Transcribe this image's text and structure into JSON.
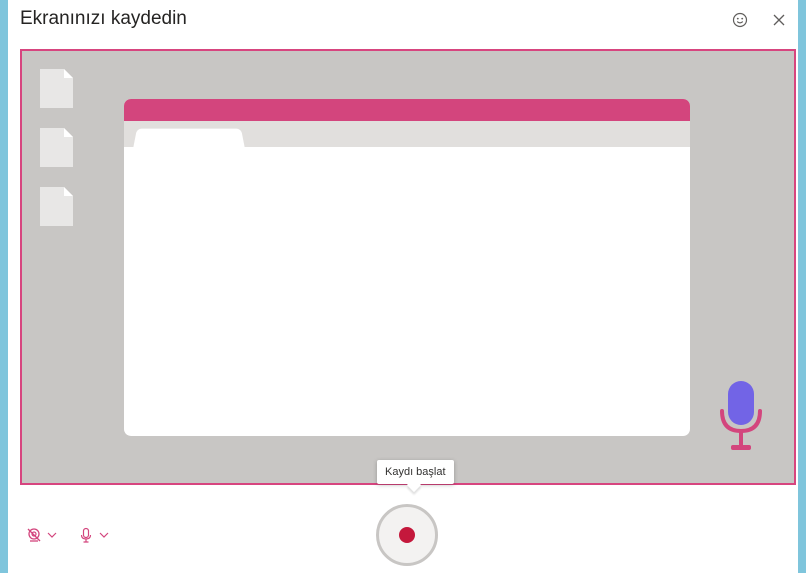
{
  "dialog": {
    "title": "Ekranınızı kaydedin"
  },
  "title_bar": {
    "feedback_icon": "smiley-icon",
    "close_icon": "close-icon"
  },
  "preview": {
    "desktop_file_icons": [
      "file-icon",
      "file-icon",
      "file-icon"
    ],
    "mic_illustration_icon": "microphone-icon"
  },
  "record": {
    "tooltip": "Kaydı başlat"
  },
  "controls": {
    "camera_icon": "camera-off-icon",
    "microphone_icon": "microphone-icon",
    "dropdown_icon": "chevron-down-icon"
  },
  "colors": {
    "accent": "#d3457d",
    "record": "#c4183c",
    "mic_body": "#7264e6",
    "stage_bg": "#c8c6c4",
    "outer_bg": "#7fc5dc"
  }
}
